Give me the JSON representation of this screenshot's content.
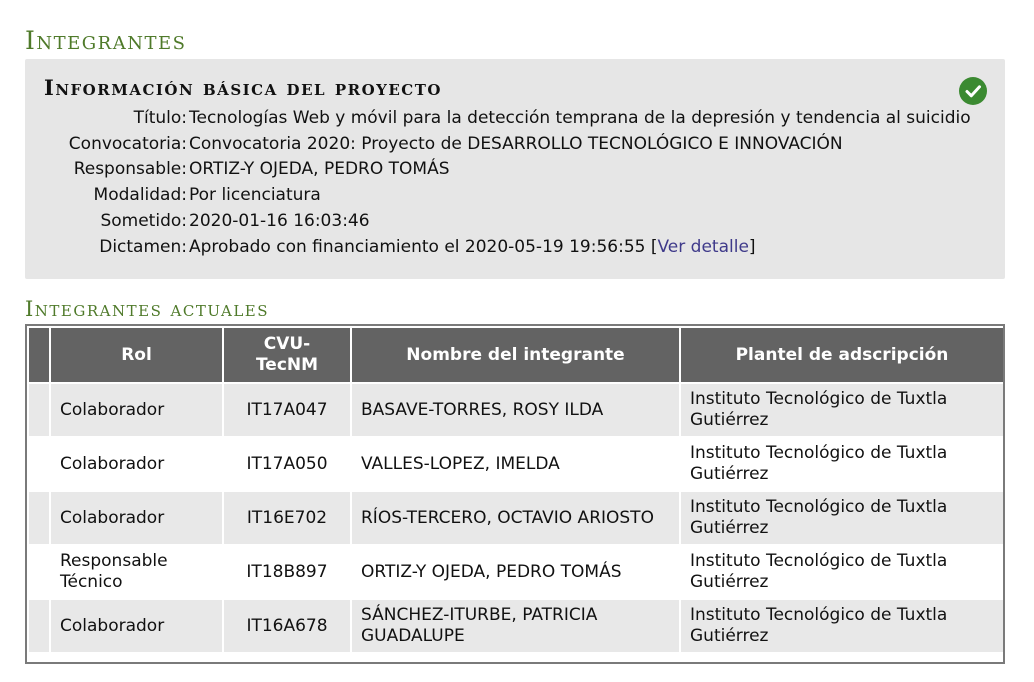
{
  "page_title": "Integrantes",
  "project_info": {
    "title": "Información básica del proyecto",
    "status_icon": "check-circle-icon",
    "status_color": "#3b8a31",
    "fields": [
      {
        "label": "Título:",
        "value": "Tecnologías Web y móvil para la detección temprana de la depresión y tendencia al suicidio"
      },
      {
        "label": "Convocatoria:",
        "value": "Convocatoria 2020: Proyecto de DESARROLLO TECNOLÓGICO E INNOVACIÓN"
      },
      {
        "label": "Responsable:",
        "value": "ORTIZ-Y OJEDA, PEDRO TOMÁS"
      },
      {
        "label": "Modalidad:",
        "value": "Por licenciatura"
      },
      {
        "label": "Sometido:",
        "value": "2020-01-16 16:03:46"
      },
      {
        "label": "Dictamen:",
        "value": "Aprobado con financiamiento el 2020-05-19 19:56:55 [",
        "link": "Ver detalle",
        "suffix": "]"
      }
    ]
  },
  "members": {
    "title": "Integrantes actuales",
    "columns": {
      "rol": "Rol",
      "cvu_line1": "CVU-",
      "cvu_line2": "TecNM",
      "nombre": "Nombre del integrante",
      "plantel": "Plantel de adscripción"
    },
    "rows": [
      {
        "rol": "Colaborador",
        "cvu": "IT17A047",
        "nombre": "BASAVE-TORRES, ROSY ILDA",
        "plantel": "Instituto Tecnológico de Tuxtla Gutiérrez"
      },
      {
        "rol": "Colaborador",
        "cvu": "IT17A050",
        "nombre": "VALLES-LOPEZ, IMELDA",
        "plantel": "Instituto Tecnológico de Tuxtla Gutiérrez"
      },
      {
        "rol": "Colaborador",
        "cvu": "IT16E702",
        "nombre": "RÍOS-TERCERO, OCTAVIO ARIOSTO",
        "plantel": "Instituto Tecnológico de Tuxtla Gutiérrez"
      },
      {
        "rol": "Responsable Técnico",
        "cvu": "IT18B897",
        "nombre": "ORTIZ-Y OJEDA, PEDRO TOMÁS",
        "plantel": "Instituto Tecnológico de Tuxtla Gutiérrez"
      },
      {
        "rol": "Colaborador",
        "cvu": "IT16A678",
        "nombre": "SÁNCHEZ-ITURBE, PATRICIA GUADALUPE",
        "plantel": "Instituto Tecnológico de Tuxtla Gutiérrez"
      }
    ]
  },
  "colors": {
    "heading": "#4f7a2a",
    "table_header": "#636363",
    "link": "#3f3a8a"
  }
}
